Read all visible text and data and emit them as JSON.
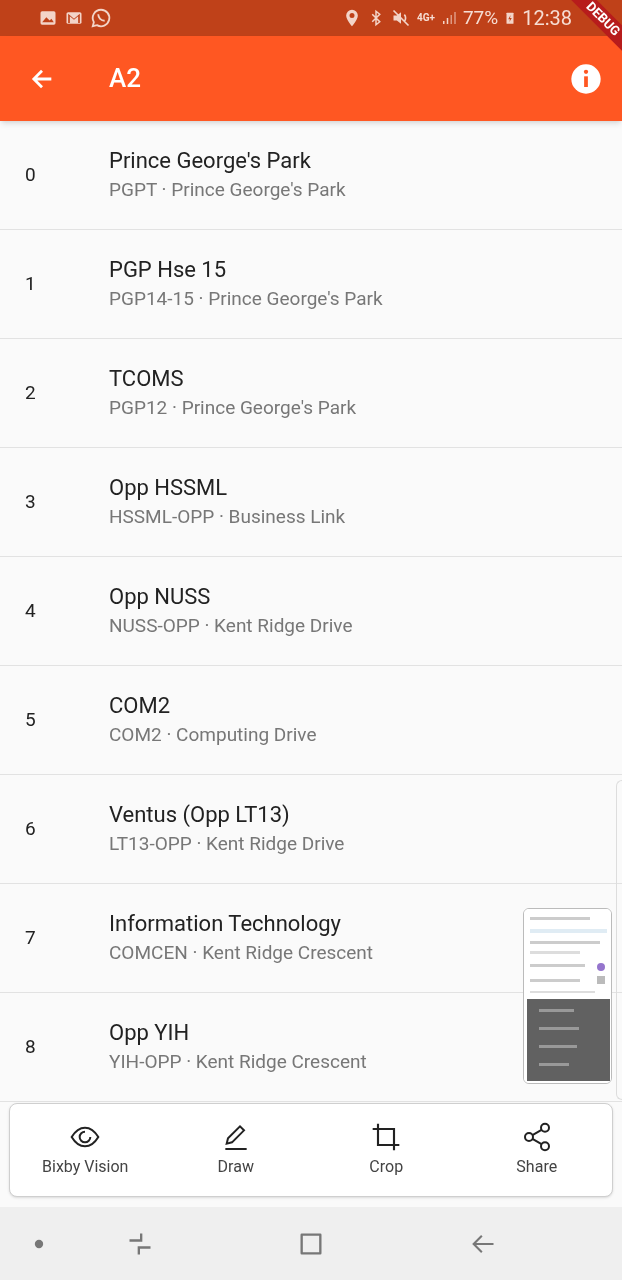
{
  "status_bar": {
    "network": "4G+",
    "battery": "77%",
    "time": "12:38"
  },
  "debug_banner": "DEBUG",
  "app_bar": {
    "title": "A2"
  },
  "stops": [
    {
      "index": "0",
      "name": "Prince George's Park",
      "detail": "PGPT · Prince George's Park"
    },
    {
      "index": "1",
      "name": "PGP Hse 15",
      "detail": "PGP14-15 · Prince George's Park"
    },
    {
      "index": "2",
      "name": "TCOMS",
      "detail": "PGP12 · Prince George's Park"
    },
    {
      "index": "3",
      "name": "Opp HSSML",
      "detail": "HSSML-OPP · Business Link"
    },
    {
      "index": "4",
      "name": "Opp NUSS",
      "detail": "NUSS-OPP · Kent Ridge Drive"
    },
    {
      "index": "5",
      "name": "COM2",
      "detail": "COM2 · Computing Drive"
    },
    {
      "index": "6",
      "name": "Ventus (Opp LT13)",
      "detail": "LT13-OPP · Kent Ridge Drive"
    },
    {
      "index": "7",
      "name": "Information Technology",
      "detail": "COMCEN · Kent Ridge Crescent"
    },
    {
      "index": "8",
      "name": "Opp YIH",
      "detail": "YIH-OPP · Kent Ridge Crescent"
    }
  ],
  "capture_toolbar": [
    {
      "kind": "eye",
      "label": "Bixby Vision"
    },
    {
      "kind": "pencil",
      "label": "Draw"
    },
    {
      "kind": "crop",
      "label": "Crop"
    },
    {
      "kind": "share",
      "label": "Share"
    }
  ]
}
